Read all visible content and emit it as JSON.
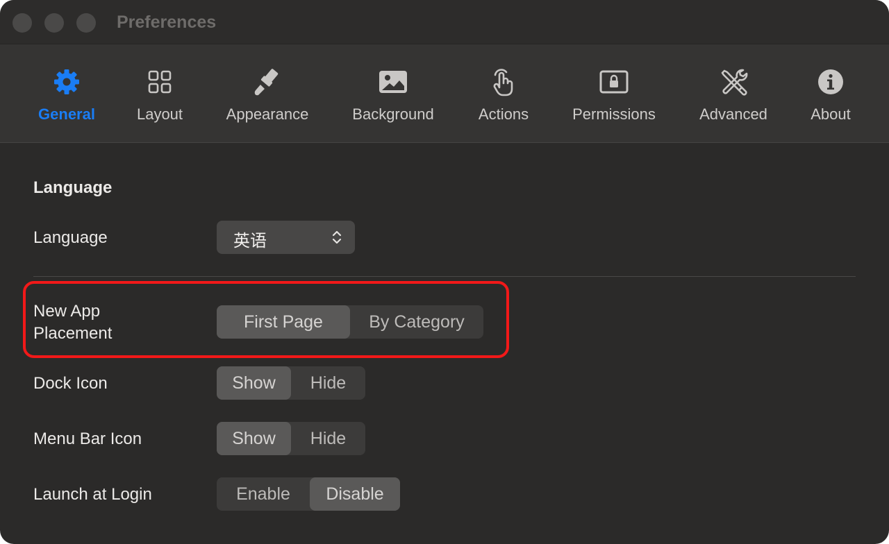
{
  "window": {
    "title": "Preferences"
  },
  "toolbar": {
    "items": [
      {
        "label": "General",
        "icon": "gear-icon",
        "active": true
      },
      {
        "label": "Layout",
        "icon": "grid-icon"
      },
      {
        "label": "Appearance",
        "icon": "paintbrush-icon"
      },
      {
        "label": "Background",
        "icon": "photo-icon"
      },
      {
        "label": "Actions",
        "icon": "hand-tap-icon"
      },
      {
        "label": "Permissions",
        "icon": "lock-display-icon"
      },
      {
        "label": "Advanced",
        "icon": "tools-icon"
      },
      {
        "label": "About",
        "icon": "info-icon"
      }
    ]
  },
  "general": {
    "section_title": "Language",
    "language": {
      "label": "Language",
      "value": "英语"
    },
    "new_app_placement": {
      "label_line1": "New App",
      "label_line2": "Placement",
      "options": [
        "First Page",
        "By Category"
      ],
      "selected": "First Page"
    },
    "dock_icon": {
      "label": "Dock Icon",
      "options": [
        "Show",
        "Hide"
      ],
      "selected": "Show"
    },
    "menu_bar_icon": {
      "label": "Menu Bar Icon",
      "options": [
        "Show",
        "Hide"
      ],
      "selected": "Show"
    },
    "launch_at_login": {
      "label": "Launch at Login",
      "options": [
        "Enable",
        "Disable"
      ],
      "selected": "Disable"
    }
  },
  "colors": {
    "accent": "#1a7df5",
    "highlight": "#f21919"
  }
}
